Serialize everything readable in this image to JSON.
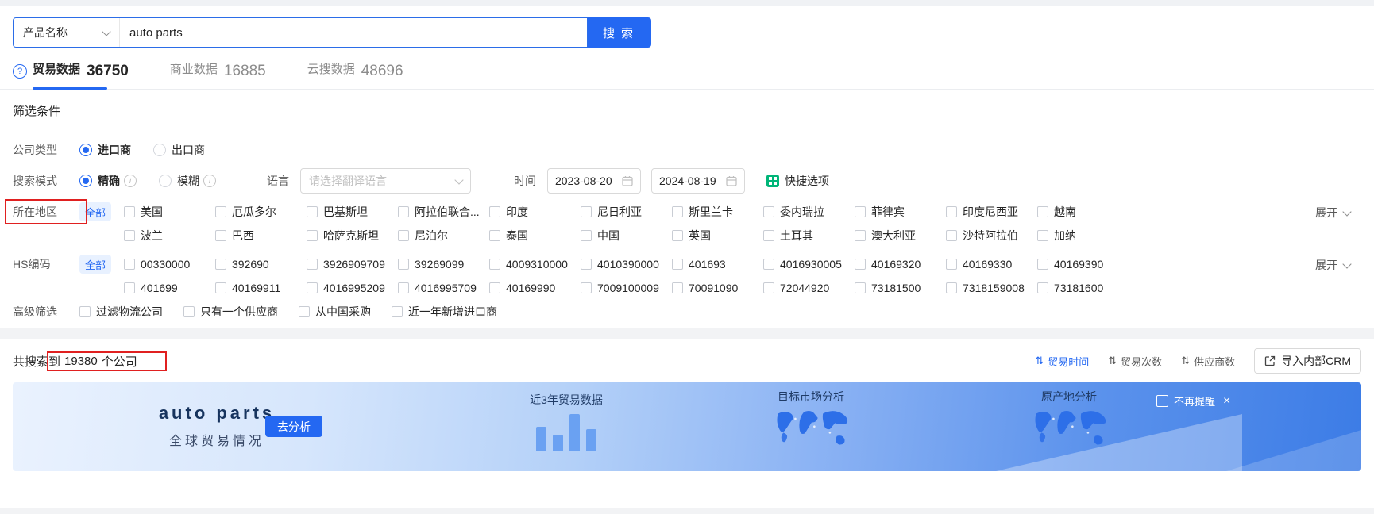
{
  "colors": {
    "primary": "#2468f2",
    "primary_light_bg": "#e8f1ff",
    "annotation_red": "#e02020",
    "quick_icon_green": "#00b578"
  },
  "icons": {
    "help": "?",
    "info": "i",
    "sort": "⇅",
    "close": "×"
  },
  "search_bar": {
    "category": "产品名称",
    "query": "auto parts",
    "search_button": "搜索"
  },
  "tabs": [
    {
      "label": "贸易数据",
      "count": "36750"
    },
    {
      "label": "商业数据",
      "count": "16885"
    },
    {
      "label": "云搜数据",
      "count": "48696"
    }
  ],
  "filters": {
    "title": "筛选条件",
    "company_type": {
      "label": "公司类型",
      "importer": "进口商",
      "exporter": "出口商"
    },
    "search_mode": {
      "label": "搜索模式",
      "exact": "精确",
      "fuzzy": "模糊"
    },
    "language": {
      "label": "语言",
      "placeholder": "请选择翻译语言"
    },
    "time": {
      "label": "时间",
      "start_date": "2023-08-20",
      "end_date": "2024-08-19",
      "quick_options": "快捷选项"
    },
    "region": {
      "label": "所在地区",
      "all_button": "全部",
      "expand": "展开",
      "row1": [
        "美国",
        "厄瓜多尔",
        "巴基斯坦",
        "阿拉伯联合...",
        "印度",
        "尼日利亚",
        "斯里兰卡",
        "委内瑞拉",
        "菲律宾",
        "印度尼西亚",
        "越南"
      ],
      "row2": [
        "波兰",
        "巴西",
        "哈萨克斯坦",
        "尼泊尔",
        "泰国",
        "中国",
        "英国",
        "土耳其",
        "澳大利亚",
        "沙特阿拉伯",
        "加纳"
      ]
    },
    "hs_code": {
      "label": "HS编码",
      "all_button": "全部",
      "expand": "展开",
      "row1": [
        "00330000",
        "392690",
        "3926909709",
        "39269099",
        "4009310000",
        "4010390000",
        "401693",
        "4016930005",
        "40169320",
        "40169330",
        "40169390"
      ],
      "row2": [
        "401699",
        "40169911",
        "4016995209",
        "4016995709",
        "40169990",
        "7009100009",
        "70091090",
        "72044920",
        "73181500",
        "7318159008",
        "73181600"
      ]
    },
    "advanced": {
      "label": "高级筛选",
      "options": [
        "过滤物流公司",
        "只有一个供应商",
        "从中国采购",
        "近一年新增进口商"
      ]
    }
  },
  "results": {
    "summary_prefix": "共搜索到",
    "count": "19380",
    "summary_suffix": "个公司",
    "sorts": [
      {
        "label": "贸易时间"
      },
      {
        "label": "贸易次数"
      },
      {
        "label": "供应商数"
      }
    ],
    "crm_button": "导入内部CRM"
  },
  "banner": {
    "title": "auto parts",
    "subtitle": "全球贸易情况",
    "analyze_button": "去分析",
    "chart_title": "近3年贸易数据",
    "market_title": "目标市场分析",
    "origin_title": "原产地分析",
    "dismiss_label": "不再提醒"
  }
}
